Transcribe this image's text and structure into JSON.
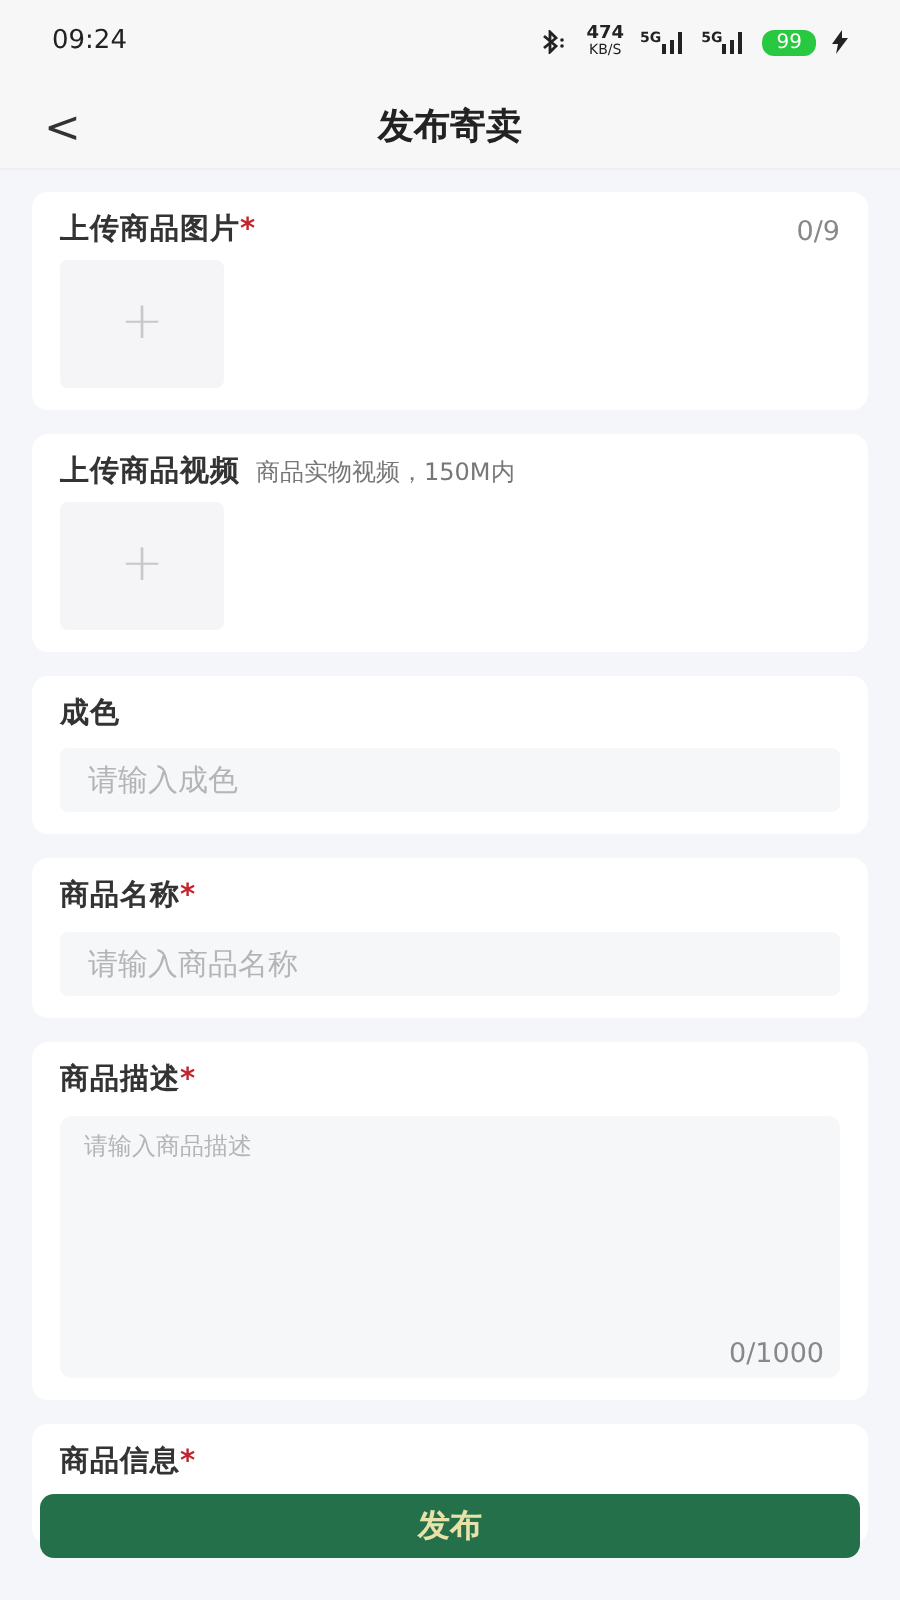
{
  "status_bar": {
    "time": "09:24",
    "speed": "474",
    "speed_unit": "KB/S",
    "signals": [
      "5G",
      "5G"
    ],
    "battery": "99",
    "charging": true
  },
  "header": {
    "back": "<",
    "title": "发布寄卖"
  },
  "sections": [
    {
      "kind": "upload",
      "label": "上传商品图片",
      "mark": "*",
      "counter": "0/9",
      "slot": "+"
    },
    {
      "kind": "upload",
      "label": "上传商品视频",
      "hint": "商品实物视频，150M内",
      "slot": "+"
    },
    {
      "kind": "input",
      "label": "成色",
      "placeholder": "请输入成色"
    },
    {
      "kind": "input",
      "label": "商品名称",
      "mark": "*",
      "placeholder": "请输入商品名称"
    },
    {
      "kind": "textarea",
      "label": "商品描述",
      "mark": "*",
      "placeholder": "请输入商品描述",
      "counter": "0/1000"
    },
    {
      "kind": "heading",
      "label": "商品信息",
      "mark": "*"
    }
  ],
  "submit": "发布"
}
